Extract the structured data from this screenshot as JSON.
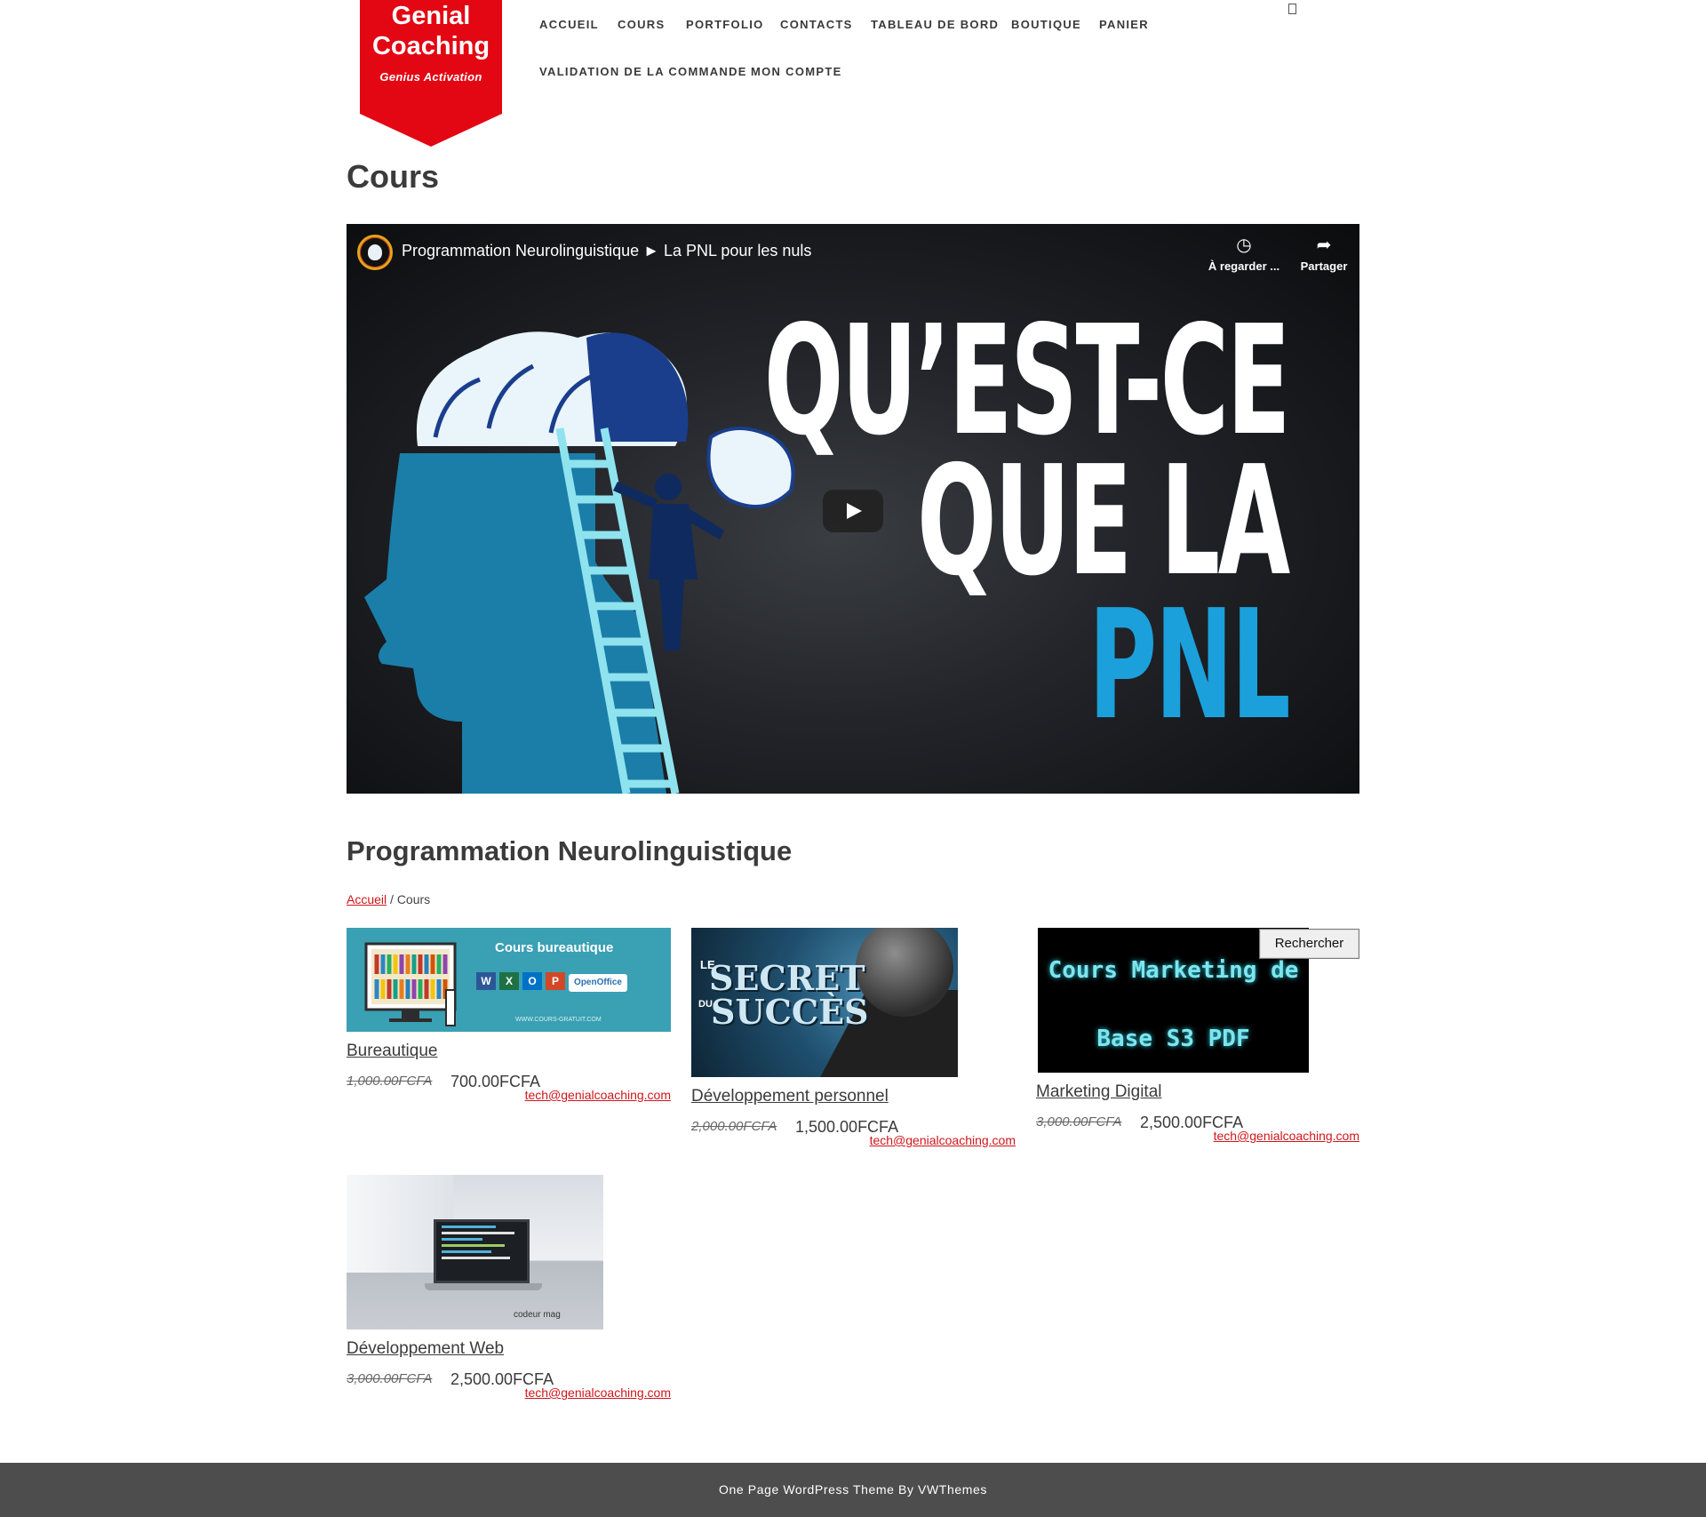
{
  "brand": {
    "line1": "Genial",
    "line2": "Coaching",
    "tagline": "Genius Activation",
    "color": "#e30613"
  },
  "nav": {
    "items": [
      "ACCUEIL",
      "COURS",
      "PORTFOLIO",
      "CONTACTS",
      "TABLEAU DE BORD",
      "BOUTIQUE",
      "PANIER",
      "VALIDATION DE LA COMMANDE",
      "MON COMPTE"
    ],
    "cart_icon": "cart-icon"
  },
  "page": {
    "title": "Cours"
  },
  "video": {
    "title": "Programmation Neurolinguistique ► La PNL pour les nuls",
    "watch_later": "À regarder ...",
    "share": "Partager",
    "thumb_line1": "QU’EST-CE",
    "thumb_line2": "QUE LA",
    "thumb_line3": "PNL",
    "accent": "#1ba0dc"
  },
  "products_section": {
    "title": "Programmation Neurolinguistique",
    "breadcrumb_home": "Accueil",
    "breadcrumb_sep": "/",
    "breadcrumb_current": "Cours",
    "search_button": "Rechercher"
  },
  "products": [
    {
      "name": "Bureautique",
      "old_price": "1,000.00FCFA",
      "price": "700.00FCFA",
      "email": "tech@genialcoaching.com",
      "thumb_title": "Cours bureautique",
      "thumb_apps": [
        "W",
        "X",
        "O",
        "P"
      ],
      "thumb_brand": "OpenOffice",
      "thumb_site": "WWW.COURS-GRATUIT.COM"
    },
    {
      "name": "Développement personnel",
      "old_price": "2,000.00FCFA",
      "price": "1,500.00FCFA",
      "email": "tech@genialcoaching.com",
      "thumb_le": "LE",
      "thumb_word1": "SECRET",
      "thumb_du": "DU",
      "thumb_word2": "SUCCÈS"
    },
    {
      "name": "Marketing Digital",
      "old_price": "3,000.00FCFA",
      "price": "2,500.00FCFA",
      "email": "tech@genialcoaching.com",
      "thumb_line1": "Cours  Marketing de",
      "thumb_line2": "Base S3 PDF"
    },
    {
      "name": "Développement Web",
      "old_price": "3,000.00FCFA",
      "price": "2,500.00FCFA",
      "email": "tech@genialcoaching.com",
      "thumb_badge": "codeur mag"
    }
  ],
  "footer": {
    "text": "One Page WordPress Theme By VWThemes"
  }
}
